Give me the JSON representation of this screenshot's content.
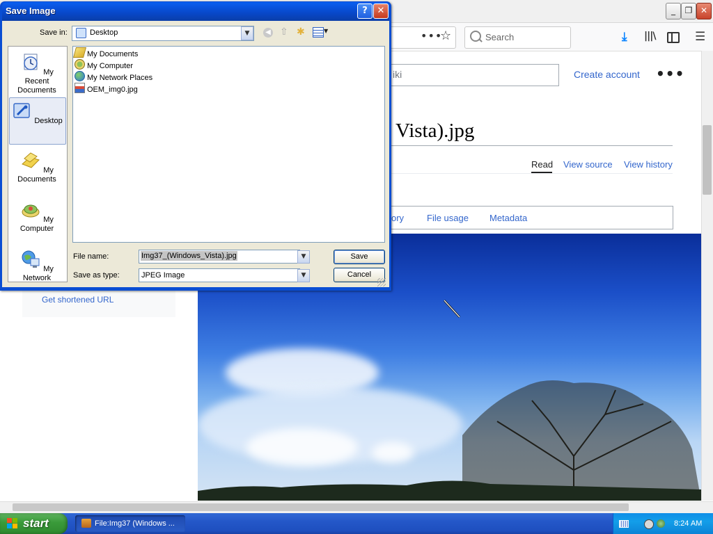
{
  "browser": {
    "search_placeholder": "Search",
    "window_buttons": {
      "minimize": "_",
      "maximize": "❐",
      "close": "✕"
    },
    "icons": [
      "download-icon",
      "library-icon",
      "sidebar-icon",
      "menu-icon",
      "bookmark-star-icon"
    ]
  },
  "wiki": {
    "search_tail": "iki",
    "create_account": "Create account",
    "more": "•••",
    "title_visible": "Vista).jpg",
    "tabs": {
      "read": "Read",
      "view_source": "View source",
      "view_history": "View history"
    },
    "file_tabs": {
      "history": "ory",
      "usage": "File usage",
      "metadata": "Metadata"
    },
    "sidebar_link": "Get shortened URL"
  },
  "dialog": {
    "title": "Save Image",
    "help": "?",
    "close": "✕",
    "save_in_label": "Save in:",
    "save_in_value": "Desktop",
    "places": [
      {
        "label": "My Recent Documents",
        "icon": "recent-documents-icon"
      },
      {
        "label": "Desktop",
        "icon": "desktop-icon"
      },
      {
        "label": "My Documents",
        "icon": "my-documents-icon"
      },
      {
        "label": "My Computer",
        "icon": "my-computer-icon"
      },
      {
        "label": "My Network",
        "icon": "my-network-icon"
      }
    ],
    "files": [
      {
        "name": "My Documents",
        "icon": "folder-icon"
      },
      {
        "name": "My Computer",
        "icon": "computer-icon"
      },
      {
        "name": "My Network Places",
        "icon": "network-icon"
      },
      {
        "name": "OEM_img0.jpg",
        "icon": "image-file-icon"
      }
    ],
    "file_name_label": "File name:",
    "file_name_value": "Img37_(Windows_Vista).jpg",
    "save_as_label": "Save as type:",
    "save_as_value": "JPEG Image",
    "save_button": "Save",
    "cancel_button": "Cancel"
  },
  "taskbar": {
    "start": "start",
    "task": "File:Img37 (Windows ...",
    "clock": "8:24 AM"
  }
}
